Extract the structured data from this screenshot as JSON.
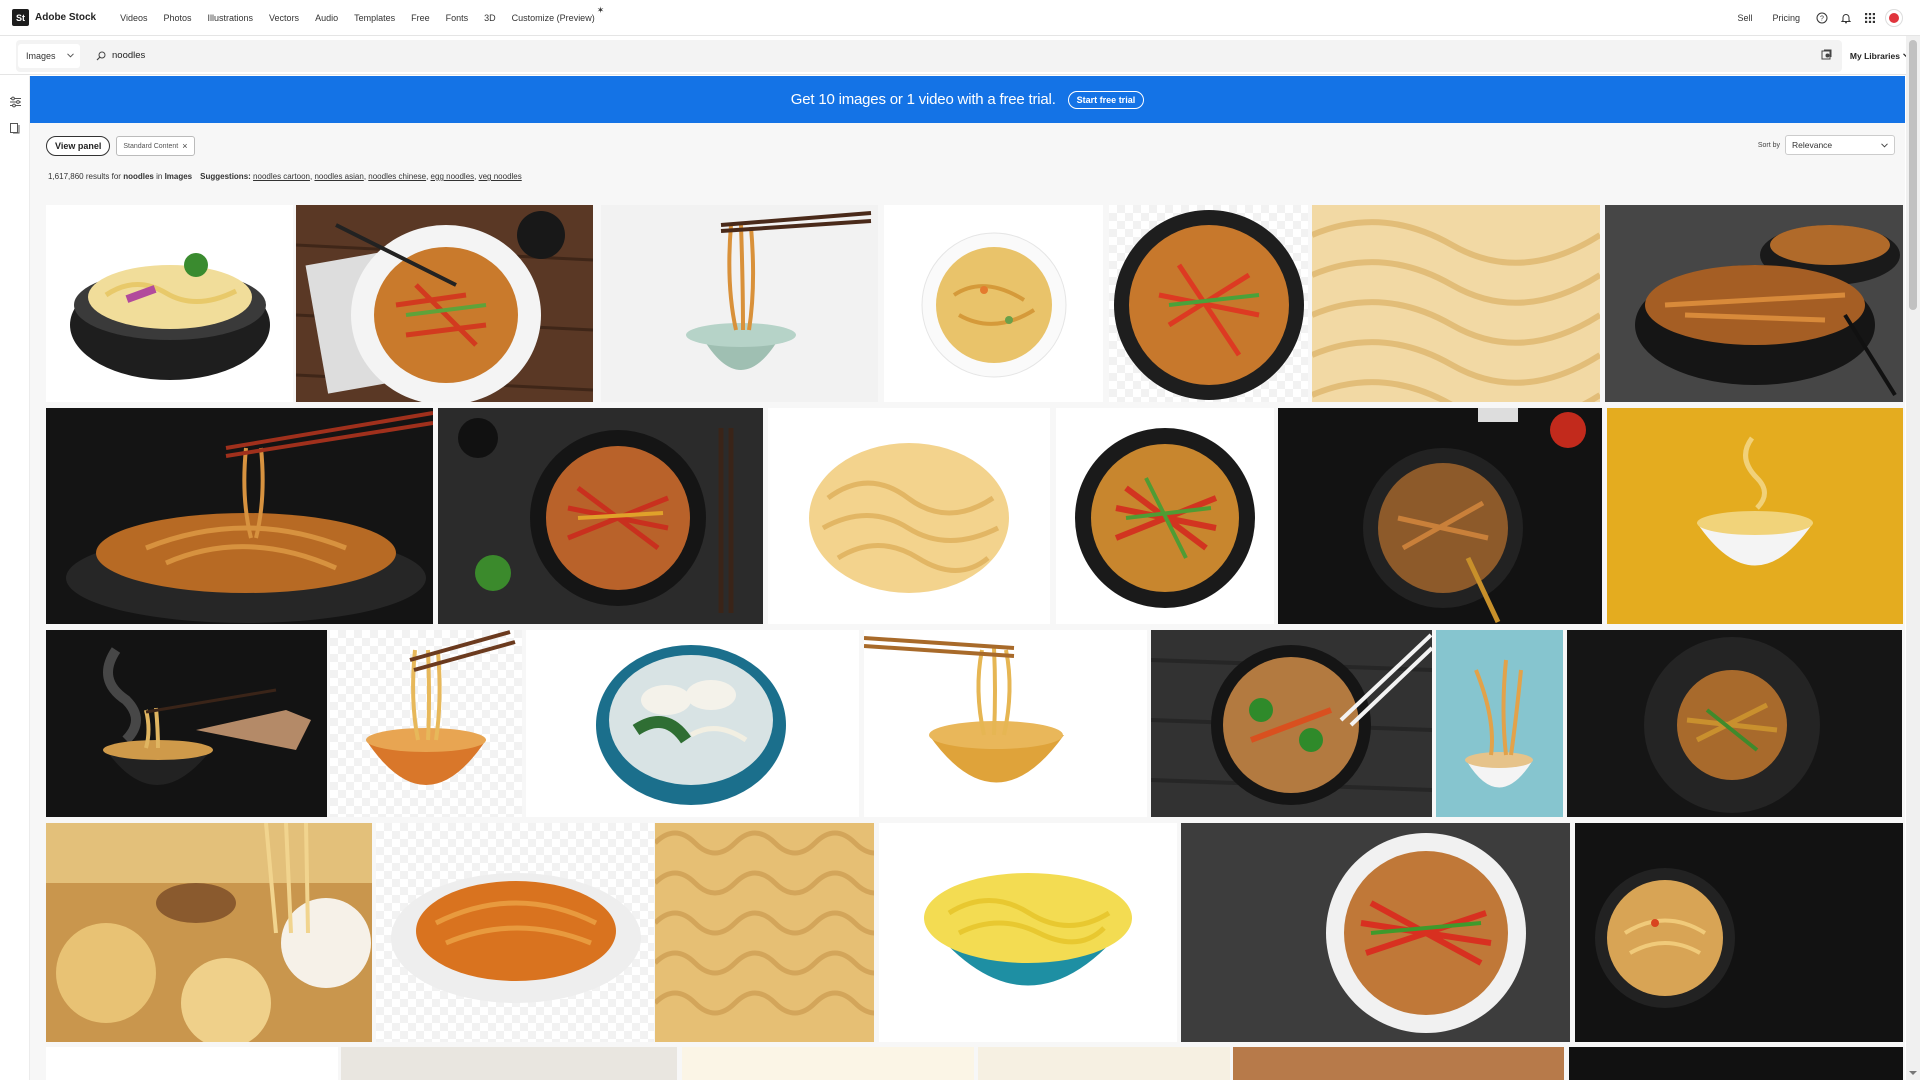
{
  "brand": {
    "mark": "St",
    "name": "Adobe Stock"
  },
  "nav": {
    "links": [
      "Videos",
      "Photos",
      "Illustrations",
      "Vectors",
      "Audio",
      "Templates",
      "Free",
      "Fonts",
      "3D",
      "Customize (Preview)"
    ],
    "sell": "Sell",
    "pricing": "Pricing",
    "icons": [
      "help-icon",
      "bell-icon",
      "apps-grid-icon",
      "avatar"
    ]
  },
  "search": {
    "type_value": "Images",
    "query": "noodles",
    "libraries_label": "My Libraries"
  },
  "banner": {
    "text": "Get 10 images or 1 video with a free trial.",
    "cta": "Start free trial",
    "color": "#1473e6"
  },
  "filters": {
    "view_panel": "View panel",
    "chip": "Standard Content"
  },
  "sort": {
    "label": "Sort by",
    "value": "Relevance"
  },
  "results": {
    "count": "1,617,860",
    "text_for": "results for",
    "term": "noodles",
    "text_in": "in",
    "category": "Images",
    "suggestions_label": "Suggestions:",
    "suggestions": [
      "noodles cartoon",
      "noodles asian",
      "noodles chinese",
      "egg noodles",
      "veg noodles"
    ]
  },
  "grid": {
    "rows": [
      [
        "bowl of noodles with vegetables on white",
        "chow mein plate with chopsticks on wood",
        "noodles lifted with chopsticks from bowl",
        "bowl of instant noodles top view",
        "stir fried noodles in dark bowl",
        "raw wavy noodles texture",
        "chicken noodles in black bowls"
      ],
      [
        "noodles with chopsticks in dark pan",
        "vegetable noodles with soy sauce and chopsticks",
        "dried instant noodle block",
        "vegetable chow mein in black bowl",
        "noodles in pan on dark background",
        "steaming bowl of noodles on yellow"
      ],
      [
        "steaming noodles with chopsticks",
        "noodles lifted from orange bowl",
        "dumpling soup with noodles",
        "noodles with chopsticks over yellow bowl",
        "noodles with broccoli and chopsticks",
        "flying noodles above bowl on blue",
        "noodles on black plate"
      ],
      [
        "assorted dry pasta",
        "spaghetti on white plate",
        "instant noodles texture",
        "yellow noodles in teal bowl",
        "vegetable noodles on dark stone",
        "noodles on dark background"
      ]
    ]
  }
}
